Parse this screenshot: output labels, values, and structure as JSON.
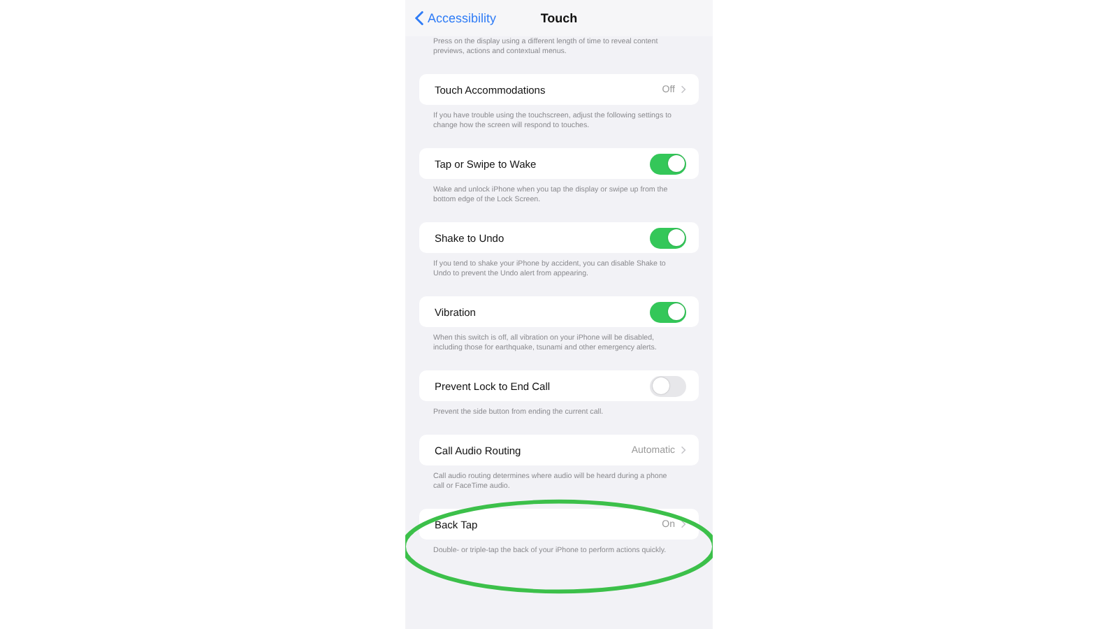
{
  "nav": {
    "back_label": "Accessibility",
    "title": "Touch"
  },
  "sections": [
    {
      "footer": "Press on the display using a different length of time to reveal content previews, actions and contextual menus."
    },
    {
      "row": {
        "label": "Touch Accommodations",
        "kind": "value",
        "value": "Off"
      },
      "footer": "If you have trouble using the touchscreen, adjust the following settings to change how the screen will respond to touches."
    },
    {
      "row": {
        "label": "Tap or Swipe to Wake",
        "kind": "toggle",
        "on": true
      },
      "footer": "Wake and unlock iPhone when you tap the display or swipe up from the bottom edge of the Lock Screen."
    },
    {
      "row": {
        "label": "Shake to Undo",
        "kind": "toggle",
        "on": true
      },
      "footer": "If you tend to shake your iPhone by accident, you can disable Shake to Undo to prevent the Undo alert from appearing."
    },
    {
      "row": {
        "label": "Vibration",
        "kind": "toggle",
        "on": true
      },
      "footer": "When this switch is off, all vibration on your iPhone will be disabled, including those for earthquake, tsunami and other emergency alerts."
    },
    {
      "row": {
        "label": "Prevent Lock to End Call",
        "kind": "toggle",
        "on": false
      },
      "footer": "Prevent the side button from ending the current call."
    },
    {
      "row": {
        "label": "Call Audio Routing",
        "kind": "value",
        "value": "Automatic"
      },
      "footer": "Call audio routing determines where audio will be heard during a phone call or FaceTime audio."
    },
    {
      "row": {
        "label": "Back Tap",
        "kind": "value",
        "value": "On"
      },
      "footer": "Double- or triple-tap the back of your iPhone to perform actions quickly.",
      "highlighted": true
    }
  ]
}
